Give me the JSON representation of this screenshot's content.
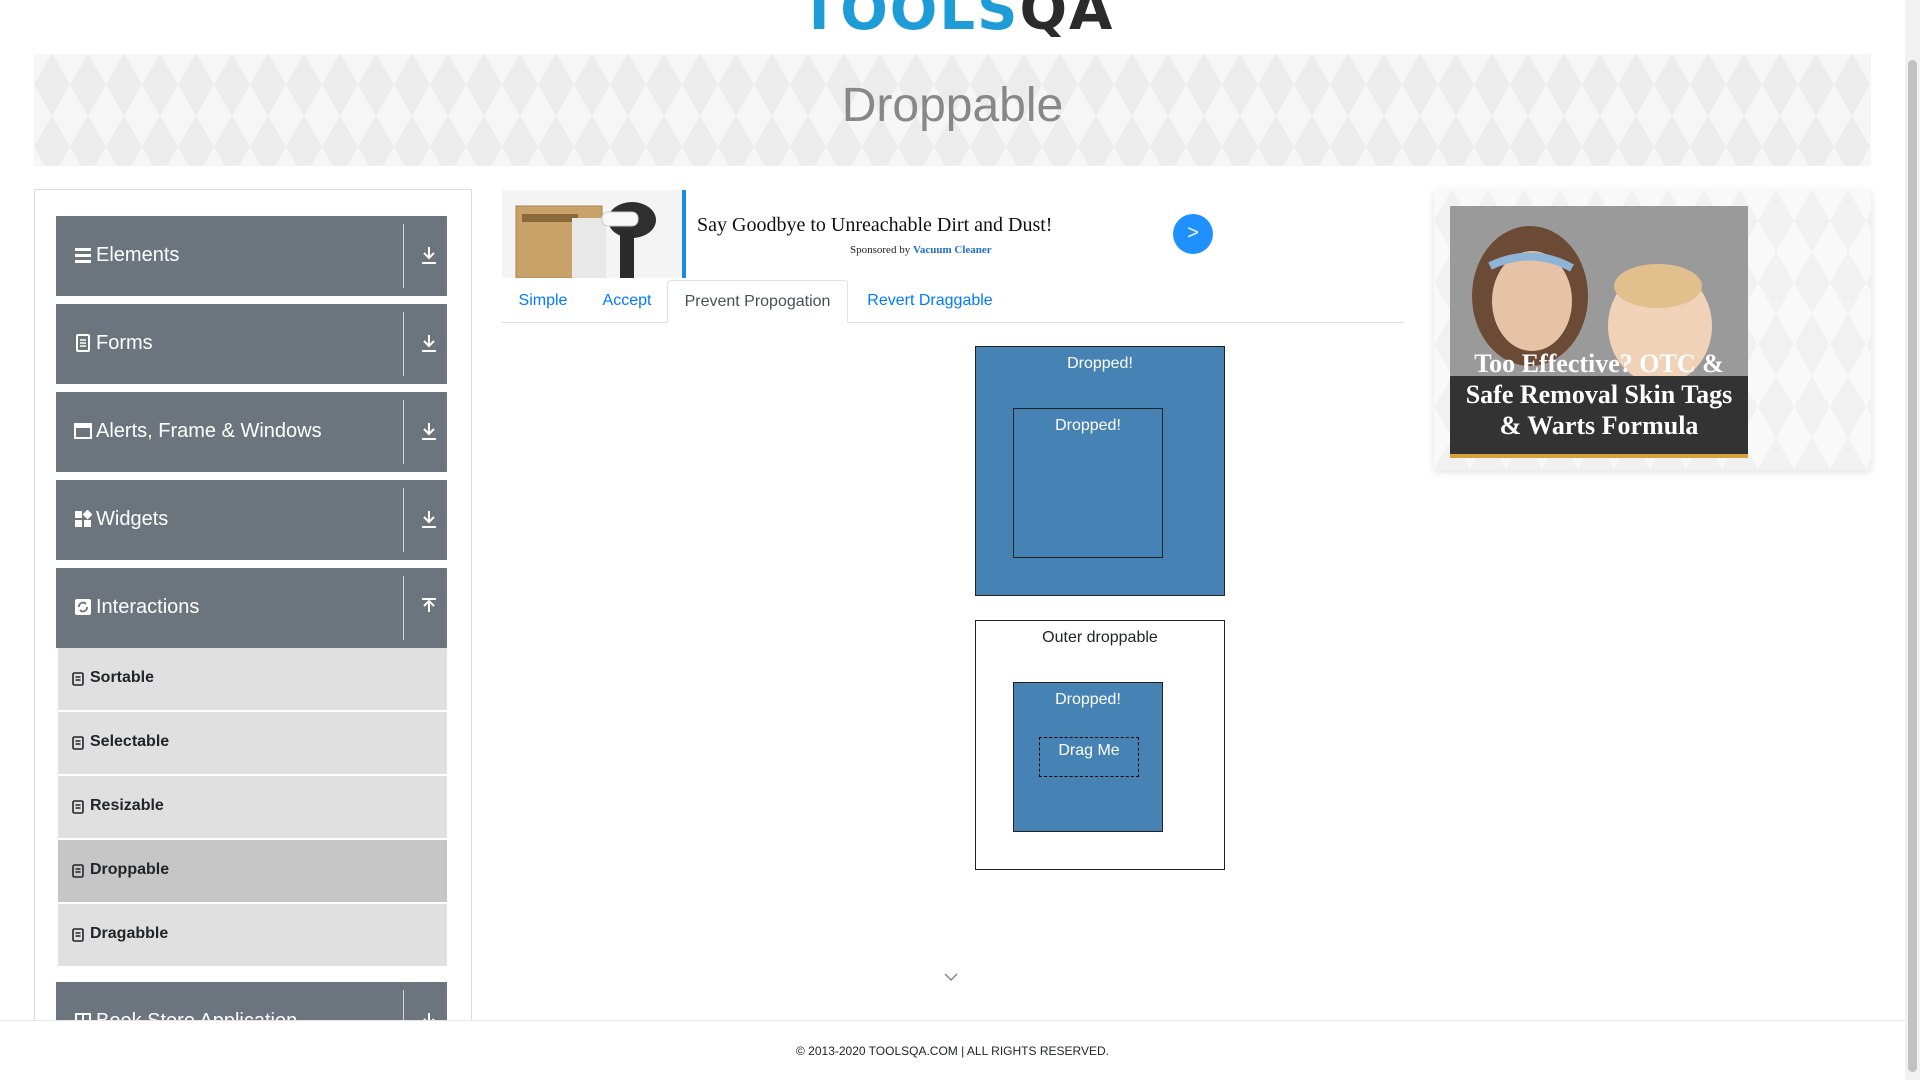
{
  "logo": {
    "text_tools": "TOOLS",
    "text_qa": "QA"
  },
  "banner": {
    "title": "Droppable"
  },
  "sidebar": {
    "groups": [
      {
        "label": "Elements",
        "icon": "menu-icon",
        "arrow": "download-icon"
      },
      {
        "label": "Forms",
        "icon": "document-icon",
        "arrow": "download-icon"
      },
      {
        "label": "Alerts, Frame & Windows",
        "icon": "window-icon",
        "arrow": "download-icon"
      },
      {
        "label": "Widgets",
        "icon": "widgets-icon",
        "arrow": "download-icon"
      },
      {
        "label": "Interactions",
        "icon": "refresh-icon",
        "arrow": "upload-icon"
      },
      {
        "label": "Book Store Application",
        "icon": "book-icon",
        "arrow": "download-icon"
      }
    ],
    "items": [
      {
        "label": "Sortable"
      },
      {
        "label": "Selectable"
      },
      {
        "label": "Resizable"
      },
      {
        "label": "Droppable",
        "active": true
      },
      {
        "label": "Dragabble"
      }
    ]
  },
  "ad_top": {
    "headline": "Say Goodbye to Unreachable Dirt and Dust!",
    "sponsored_prefix": "Sponsored by",
    "sponsor": "Vacuum Cleaner",
    "button": ">"
  },
  "tabs": [
    {
      "label": "Simple"
    },
    {
      "label": "Accept"
    },
    {
      "label": "Prevent Propogation",
      "active": true
    },
    {
      "label": "Revert Draggable"
    }
  ],
  "drop": {
    "outer1_label": "Dropped!",
    "inner1_label": "Dropped!",
    "outer2_label": "Outer droppable",
    "inner2_label": "Dropped!",
    "drag_label": "Drag Me"
  },
  "ad_right": {
    "text": "Too Effective? OTC & Safe Removal Skin Tags & Warts Formula"
  },
  "footer": {
    "text": "© 2013-2020 TOOLSQA.COM | ALL RIGHTS RESERVED."
  },
  "colors": {
    "accent": "#007bff",
    "sidebar_header": "#6c757d",
    "drop_blue": "#4682b4"
  }
}
